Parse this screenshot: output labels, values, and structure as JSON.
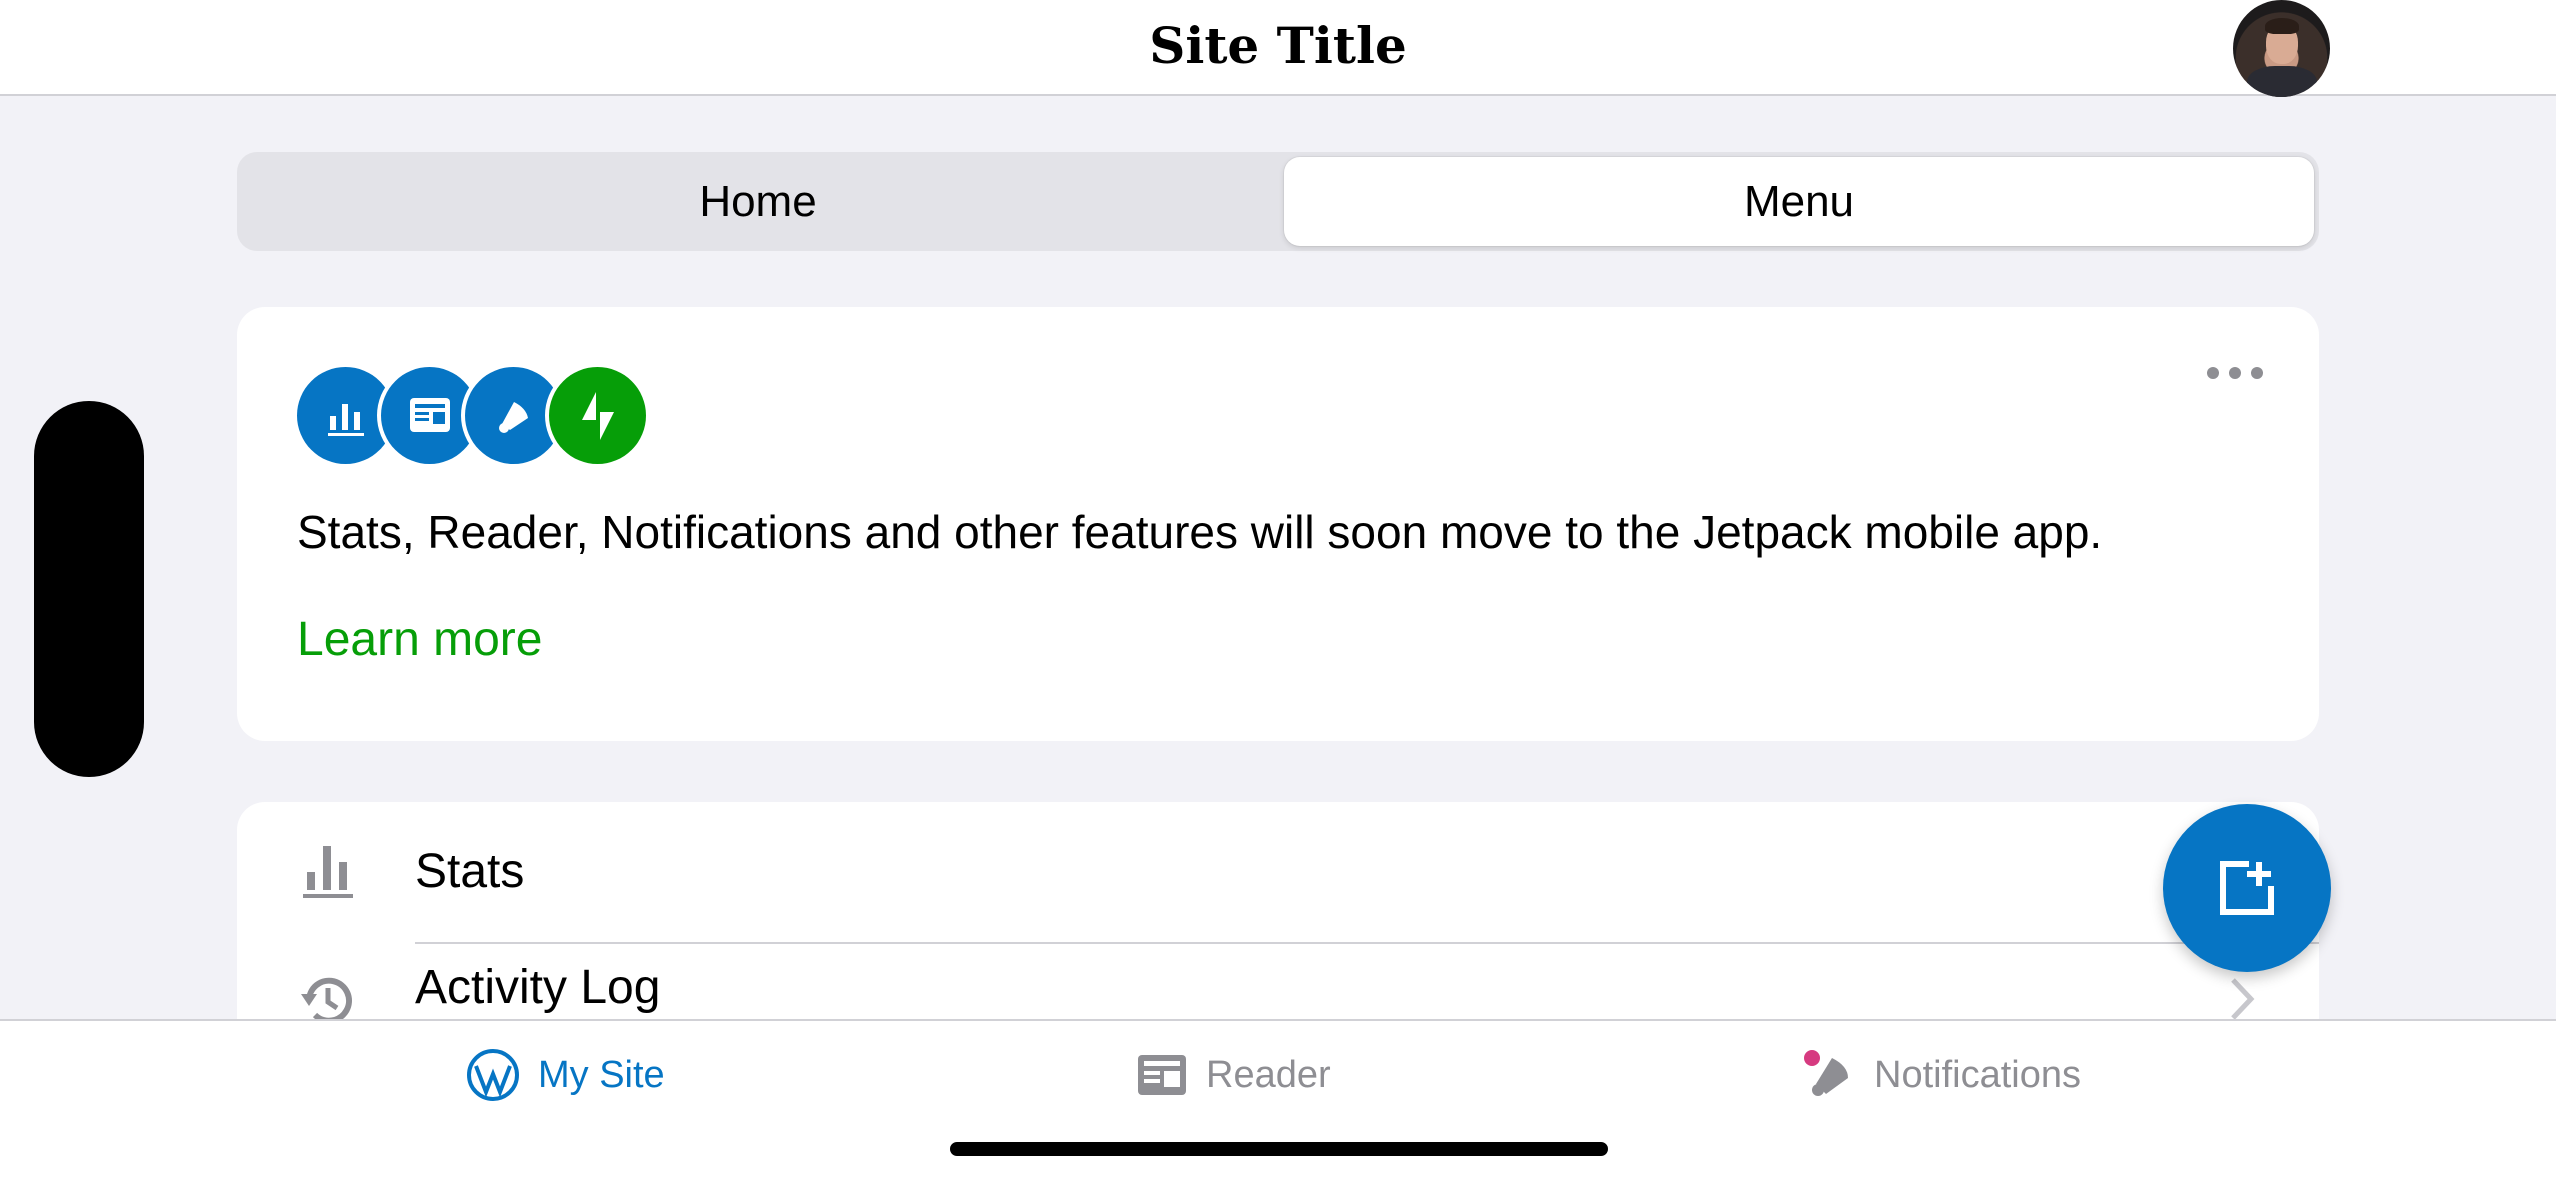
{
  "header": {
    "title": "Site Title",
    "avatar_alt": "user avatar"
  },
  "segmented_control": {
    "tabs": [
      {
        "label": "Home",
        "selected": false
      },
      {
        "label": "Menu",
        "selected": true
      }
    ]
  },
  "jetpack_card": {
    "badges": [
      "stats-icon",
      "reader-icon",
      "notifications-icon",
      "jetpack-icon"
    ],
    "message": "Stats, Reader, Notifications and other features will soon move to the Jetpack mobile app.",
    "link_label": "Learn more",
    "more_icon": "ellipsis-icon",
    "link_color": "#069e08"
  },
  "menu_list": {
    "items": [
      {
        "label": "Stats",
        "icon": "stats-icon"
      },
      {
        "label": "Activity Log",
        "icon": "history-icon"
      }
    ]
  },
  "fab": {
    "icon": "new-post-icon",
    "color": "#0675c4"
  },
  "tab_bar": {
    "tabs": [
      {
        "label": "My Site",
        "icon": "wordpress-icon",
        "active": true
      },
      {
        "label": "Reader",
        "icon": "reader-icon",
        "active": false
      },
      {
        "label": "Notifications",
        "icon": "bell-icon",
        "active": false,
        "badge": true
      }
    ],
    "active_color": "#0675c4",
    "inactive_color": "#8e8e93"
  }
}
